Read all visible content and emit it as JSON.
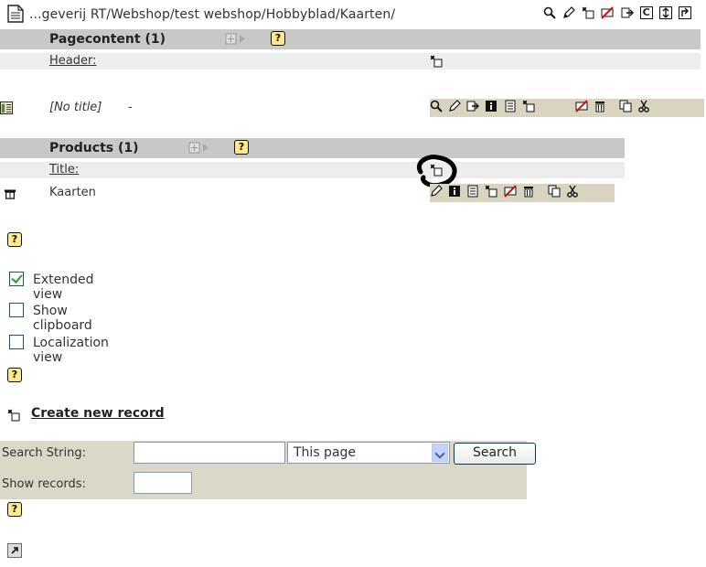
{
  "path": {
    "text": "...geverij RT/Webshop/test webshop/Hobbyblad/Kaarten/",
    "icons": [
      "page-icon",
      "magnify-icon",
      "edit-icon",
      "new-icon",
      "hide-icon",
      "move-icon",
      "clear-cache-icon",
      "sort-icon",
      "up-level-icon"
    ],
    "clear_cache_label": "C"
  },
  "pagecontent": {
    "title": "Pagecontent (1)",
    "field_link": "Header:",
    "record": {
      "label": "[No title]",
      "suffix": "-",
      "icons": [
        "magnify-icon",
        "edit-icon",
        "move-icon",
        "info-icon",
        "history-icon",
        "new-icon",
        "hide-icon",
        "delete-icon",
        "copy-icon",
        "cut-icon"
      ]
    }
  },
  "products": {
    "title": "Products (1)",
    "field_link": "Title:",
    "record": {
      "label": "Kaarten",
      "icons": [
        "edit-icon",
        "info-icon",
        "history-icon",
        "new-icon",
        "hide-icon",
        "delete-icon",
        "copy-icon",
        "cut-icon"
      ]
    }
  },
  "options": {
    "extended_view": {
      "label": "Extended view",
      "checked": true
    },
    "show_clipboard": {
      "label": "Show clipboard",
      "checked": false
    },
    "localization_view": {
      "label": "Localization view",
      "checked": false
    }
  },
  "help_label": "?",
  "create_new_record": "Create new record",
  "search": {
    "string_label": "Search String:",
    "string_value": "",
    "scope_value": "This page",
    "button_label": "Search",
    "show_records_label": "Show records:",
    "show_records_value": ""
  },
  "colors": {
    "header_bar": "#c8c8c8",
    "field_row": "#ededed",
    "icon_strip": "#d8d4c0",
    "search_bg": "#dcd8c8",
    "help_bg": "#ffe98a",
    "checkbox_border": "#1c5180"
  }
}
